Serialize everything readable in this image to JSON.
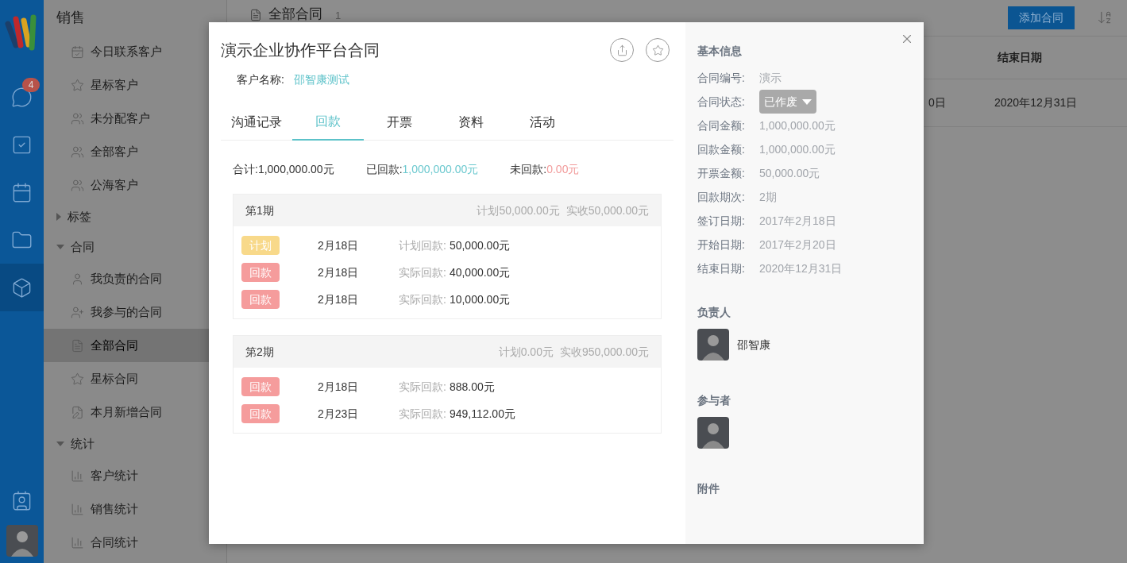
{
  "rail": {
    "items": [
      {
        "selected": false,
        "badge": "4"
      },
      {
        "selected": false
      },
      {
        "selected": false
      },
      {
        "selected": false
      },
      {
        "selected": true
      }
    ],
    "bottom": [
      {
        "selected": false
      }
    ]
  },
  "sidebar": {
    "title": "销售",
    "items": [
      {
        "kind": "item",
        "label": "今日联系客户",
        "selected": false
      },
      {
        "kind": "item",
        "label": "星标客户",
        "selected": false
      },
      {
        "kind": "item",
        "label": "未分配客户",
        "selected": false
      },
      {
        "kind": "item",
        "label": "全部客户",
        "selected": false
      },
      {
        "kind": "item",
        "label": "公海客户",
        "selected": false
      },
      {
        "kind": "group",
        "label": "标签",
        "expanded": false
      },
      {
        "kind": "group",
        "label": "合同",
        "expanded": true,
        "children": [
          {
            "kind": "item",
            "label": "我负责的合同",
            "selected": false
          },
          {
            "kind": "item",
            "label": "我参与的合同",
            "selected": false
          },
          {
            "kind": "item",
            "label": "全部合同",
            "selected": true
          },
          {
            "kind": "item",
            "label": "星标合同",
            "selected": false
          },
          {
            "kind": "item",
            "label": "本月新增合同",
            "selected": false
          }
        ]
      },
      {
        "kind": "group",
        "label": "统计",
        "expanded": true,
        "children": [
          {
            "kind": "item",
            "label": "客户统计",
            "selected": false
          },
          {
            "kind": "item",
            "label": "销售统计",
            "selected": false
          },
          {
            "kind": "item",
            "label": "合同统计",
            "selected": false
          }
        ]
      }
    ]
  },
  "main": {
    "title": "全部合同",
    "count": "1",
    "add_button": "添加合同",
    "table": {
      "end_date_header": "结束日期",
      "row": {
        "column_1": "0日",
        "end_date": "2020年12月31日"
      }
    }
  },
  "dialog": {
    "title": "演示企业协作平台合同",
    "customer_label": "客户名称:",
    "customer_value": "邵智康测试",
    "tabs": [
      {
        "label": "沟通记录",
        "selected": false
      },
      {
        "label": "回款",
        "selected": true
      },
      {
        "label": "开票",
        "selected": false
      },
      {
        "label": "资料",
        "selected": false
      },
      {
        "label": "活动",
        "selected": false
      }
    ],
    "summary": [
      {
        "label": "合计:",
        "value": "1,000,000.00元",
        "kind": "total"
      },
      {
        "label": "已回款:",
        "value": "1,000,000.00元",
        "kind": "paid"
      },
      {
        "label": "未回款:",
        "value": "0.00元",
        "kind": "unpaid"
      }
    ],
    "periods": [
      {
        "title": "第1期",
        "plan": "计划50,000.00元",
        "actual": "实收50,000.00元",
        "entries": [
          {
            "kind": "plan",
            "tag": "计划",
            "date": "2月18日",
            "label": "计划回款:",
            "amount": "50,000.00元"
          },
          {
            "kind": "payment",
            "tag": "回款",
            "date": "2月18日",
            "label": "实际回款:",
            "amount": "40,000.00元"
          },
          {
            "kind": "payment",
            "tag": "回款",
            "date": "2月18日",
            "label": "实际回款:",
            "amount": "10,000.00元"
          }
        ]
      },
      {
        "title": "第2期",
        "plan": "计划0.00元",
        "actual": "实收950,000.00元",
        "entries": [
          {
            "kind": "payment",
            "tag": "回款",
            "date": "2月18日",
            "label": "实际回款:",
            "amount": "888.00元"
          },
          {
            "kind": "payment",
            "tag": "回款",
            "date": "2月23日",
            "label": "实际回款:",
            "amount": "949,112.00元"
          }
        ]
      }
    ],
    "info": {
      "title": "基本信息",
      "fields": [
        {
          "kind": "text",
          "label": "合同编号:",
          "value": "演示"
        },
        {
          "kind": "dropdown",
          "label": "合同状态:",
          "value": "已作废"
        },
        {
          "kind": "text",
          "label": "合同金额:",
          "value": "1,000,000.00元"
        },
        {
          "kind": "text",
          "label": "回款金额:",
          "value": "1,000,000.00元"
        },
        {
          "kind": "text",
          "label": "开票金额:",
          "value": "50,000.00元"
        },
        {
          "kind": "text",
          "label": "回款期次:",
          "value": "2期"
        },
        {
          "kind": "text",
          "label": "签订日期:",
          "value": "2017年2月18日"
        },
        {
          "kind": "text",
          "label": "开始日期:",
          "value": "2017年2月20日"
        },
        {
          "kind": "text",
          "label": "结束日期:",
          "value": "2020年12月31日"
        }
      ]
    },
    "owner": {
      "title": "负责人",
      "name": "邵智康"
    },
    "participants": {
      "title": "参与者"
    },
    "attachments": {
      "title": "附件"
    }
  }
}
